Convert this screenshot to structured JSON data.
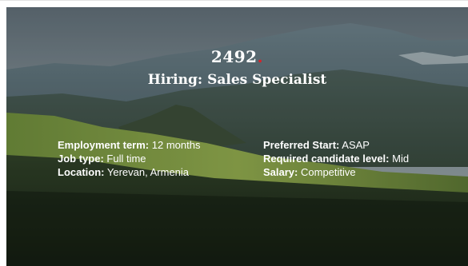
{
  "job": {
    "number": "2492",
    "number_dot": ".",
    "title": "Hiring: Sales Specialist"
  },
  "details_left": [
    {
      "label": "Employment term:",
      "value": "12 months"
    },
    {
      "label": "Job type:",
      "value": "Full time"
    },
    {
      "label": "Location:",
      "value": "Yerevan, Armenia"
    }
  ],
  "details_right": [
    {
      "label": "Preferred Start:",
      "value": "ASAP"
    },
    {
      "label": "Required candidate level:",
      "value": "Mid"
    },
    {
      "label": "Salary:",
      "value": "Competitive"
    }
  ],
  "colors": {
    "accent_dot": "#d8232a",
    "text": "#ffffff"
  }
}
